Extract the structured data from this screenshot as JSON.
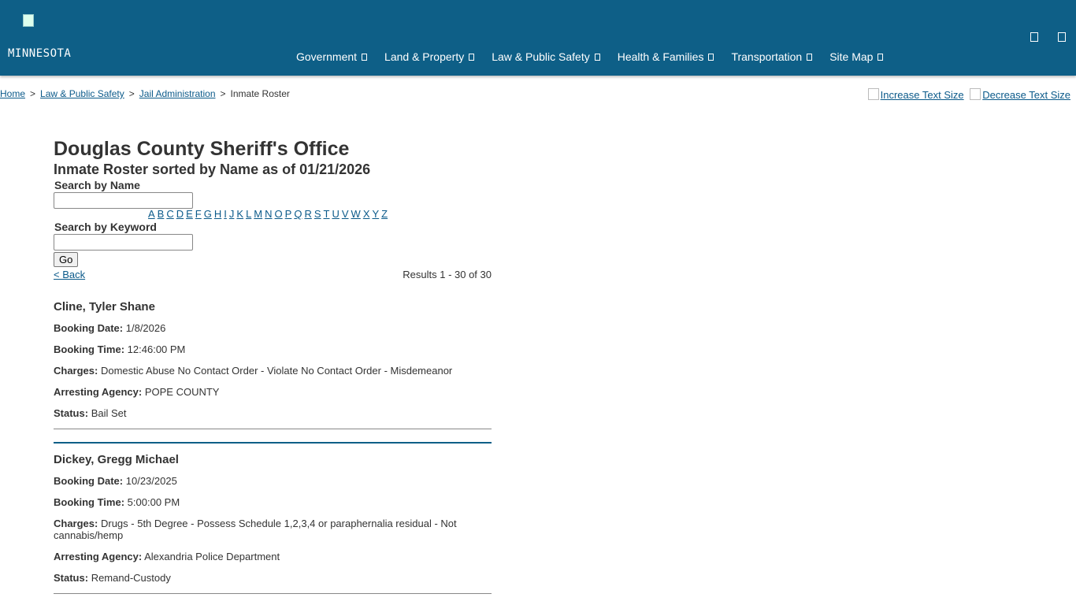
{
  "header": {
    "logo_text": "MINNESOTA",
    "nav": [
      {
        "label": "Government"
      },
      {
        "label": "Land & Property"
      },
      {
        "label": "Law & Public Safety"
      },
      {
        "label": "Health & Families"
      },
      {
        "label": "Transportation"
      },
      {
        "label": "Site Map"
      }
    ]
  },
  "breadcrumb": {
    "home": "Home",
    "law": "Law & Public Safety",
    "jail": "Jail Administration",
    "current": "Inmate Roster",
    "sep": ">"
  },
  "text_size": {
    "increase": "Increase Text Size",
    "decrease": "Decrease Text Size"
  },
  "page": {
    "title": "Douglas County Sheriff's Office",
    "subtitle": "Inmate Roster sorted by Name as of 01/21/2026",
    "search_name_label": "Search by Name",
    "search_name_value": "",
    "letters": [
      "A",
      "B",
      "C",
      "D",
      "E",
      "F",
      "G",
      "H",
      "I",
      "J",
      "K",
      "L",
      "M",
      "N",
      "O",
      "P",
      "Q",
      "R",
      "S",
      "T",
      "U",
      "V",
      "W",
      "X",
      "Y",
      "Z"
    ],
    "search_keyword_label": "Search by Keyword",
    "search_keyword_value": "",
    "go_label": "Go",
    "back_label": "< Back",
    "results_text": "Results 1 - 30 of 30"
  },
  "labels": {
    "booking_date": "Booking Date:",
    "booking_time": "Booking Time:",
    "charges": "Charges:",
    "agency": "Arresting Agency:",
    "status": "Status:"
  },
  "inmates": [
    {
      "name": "Cline, Tyler Shane",
      "booking_date": "1/8/2026",
      "booking_time": "12:46:00 PM",
      "charges": "Domestic Abuse No Contact Order - Violate No Contact Order - Misdemeanor",
      "agency": "POPE COUNTY",
      "status": "Bail Set"
    },
    {
      "name": "Dickey, Gregg Michael",
      "booking_date": "10/23/2025",
      "booking_time": "5:00:00 PM",
      "charges": "Drugs - 5th Degree - Possess Schedule 1,2,3,4 or paraphernalia residual - Not cannabis/hemp",
      "agency": "Alexandria Police Department",
      "status": "Remand-Custody"
    }
  ],
  "colors": {
    "header_bg": "#0e5f87",
    "link": "#0b5a8a"
  }
}
